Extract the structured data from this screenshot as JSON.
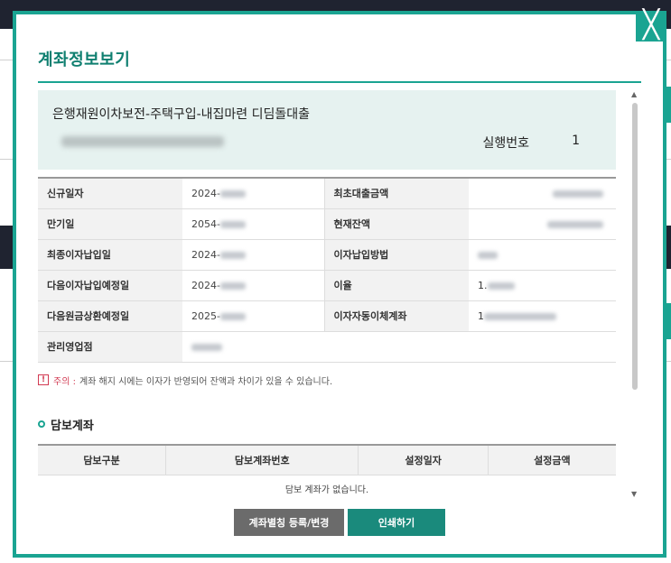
{
  "modal": {
    "title": "계좌정보보기",
    "close_label": "╳"
  },
  "account": {
    "name": "은행재원이차보전-주택구입-내집마련 디딤돌대출",
    "exec_label": "실행번호",
    "exec_value": "1"
  },
  "info_rows": [
    {
      "label1": "신규일자",
      "value1": "2024-",
      "label2": "최초대출금액",
      "value2": ""
    },
    {
      "label1": "만기일",
      "value1": "2054-",
      "label2": "현재잔액",
      "value2": ""
    },
    {
      "label1": "최종이자납입일",
      "value1": "2024-",
      "label2": "이자납입방법",
      "value2": ""
    },
    {
      "label1": "다음이자납입예정일",
      "value1": "2024-",
      "label2": "이율",
      "value2": "1."
    },
    {
      "label1": "다음원금상환예정일",
      "value1": "2025-",
      "label2": "이자자동이체계좌",
      "value2": "1"
    },
    {
      "label1": "관리영업점",
      "value1": ""
    }
  ],
  "notice": {
    "icon": "!",
    "label": "주의 :",
    "text": "계좌 해지 시에는 이자가 반영되어 잔액과 차이가 있을 수 있습니다."
  },
  "collateral": {
    "title": "담보계좌",
    "headers": [
      "담보구분",
      "담보계좌번호",
      "설정일자",
      "설정금액"
    ],
    "empty_text": "담보 계좌가 없습니다."
  },
  "buttons": {
    "register": "계좌별칭 등록/변경",
    "print": "인쇄하기"
  },
  "colors": {
    "accent": "#1aa492",
    "title": "#0f7f70",
    "notice": "#d23a52"
  }
}
